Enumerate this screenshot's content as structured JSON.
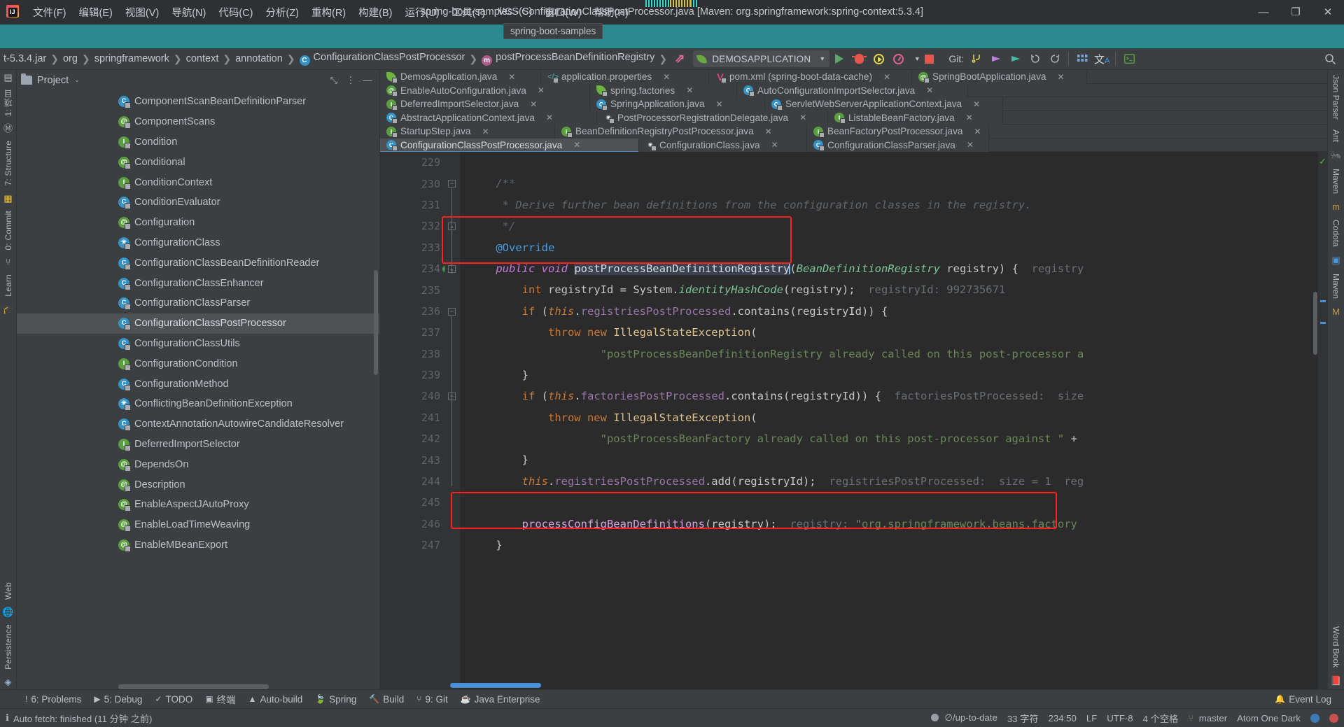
{
  "titlebar": {
    "menus": [
      "文件(F)",
      "编辑(E)",
      "视图(V)",
      "导航(N)",
      "代码(C)",
      "分析(Z)",
      "重构(R)",
      "构建(B)",
      "运行(U)",
      "工具(T)",
      "VCS(S)",
      "窗口(W)",
      "帮助(H)"
    ],
    "window_title": "spring-boot-samples - ConfigurationClassPostProcessor.java [Maven: org.springframework:spring-context:5.3.4]",
    "minimize": "—",
    "restore": "❐",
    "close": "✕"
  },
  "project_tooltip": "spring-boot-samples",
  "breadcrumb": {
    "items": [
      "t-5.3.4.jar",
      "org",
      "springframework",
      "context",
      "annotation",
      "ConfigurationClassPostProcessor",
      "postProcessBeanDefinitionRegistry"
    ],
    "separator": "❯"
  },
  "toolbar": {
    "run_config": "DEMOSAPPLICATION",
    "run_config_caret": "▼",
    "run": "run-button",
    "debug": "debug-button",
    "run_coverage": "run-with-coverage-button",
    "profile": "profiler-button",
    "stop": "stop-button",
    "git_label": "Git:",
    "update": "update-project",
    "commit": "commit",
    "push": "push",
    "history": "history",
    "rollback": "rollback",
    "search": "search-everywhere"
  },
  "left_rail": {
    "project": "1: 项目",
    "structure": "7: Structure",
    "commit": "0: Commit",
    "learn": "Learn",
    "web": "Web",
    "persistence": "Persistence"
  },
  "right_rail": {
    "json_parser": "Json Parser",
    "ant": "Ant",
    "maven": "Maven",
    "codota": "Codota",
    "word_book": "Word Book"
  },
  "project_panel": {
    "title": "Project",
    "caret": "⌄",
    "collapse_icon": "collapse-all-icon",
    "options_icon": "options-icon",
    "hide_icon": "hide-icon",
    "tree": [
      {
        "label": "ComponentScanBeanDefinitionParser",
        "type": "c",
        "selected": false
      },
      {
        "label": "ComponentScans",
        "type": "a",
        "selected": false
      },
      {
        "label": "Condition",
        "type": "i",
        "selected": false
      },
      {
        "label": "Conditional",
        "type": "a",
        "selected": false
      },
      {
        "label": "ConditionContext",
        "type": "i",
        "selected": false
      },
      {
        "label": "ConditionEvaluator",
        "type": "c",
        "selected": false
      },
      {
        "label": "Configuration",
        "type": "a",
        "selected": false
      },
      {
        "label": "ConfigurationClass",
        "type": "ex",
        "selected": false
      },
      {
        "label": "ConfigurationClassBeanDefinitionReader",
        "type": "c",
        "selected": false
      },
      {
        "label": "ConfigurationClassEnhancer",
        "type": "c",
        "selected": false
      },
      {
        "label": "ConfigurationClassParser",
        "type": "c",
        "selected": false
      },
      {
        "label": "ConfigurationClassPostProcessor",
        "type": "c",
        "selected": true
      },
      {
        "label": "ConfigurationClassUtils",
        "type": "c",
        "selected": false
      },
      {
        "label": "ConfigurationCondition",
        "type": "i",
        "selected": false
      },
      {
        "label": "ConfigurationMethod",
        "type": "c",
        "selected": false
      },
      {
        "label": "ConflictingBeanDefinitionException",
        "type": "ex",
        "selected": false
      },
      {
        "label": "ContextAnnotationAutowireCandidateResolver",
        "type": "c",
        "selected": false
      },
      {
        "label": "DeferredImportSelector",
        "type": "i",
        "selected": false
      },
      {
        "label": "DependsOn",
        "type": "a",
        "selected": false
      },
      {
        "label": "Description",
        "type": "a",
        "selected": false
      },
      {
        "label": "EnableAspectJAutoProxy",
        "type": "a",
        "selected": false
      },
      {
        "label": "EnableLoadTimeWeaving",
        "type": "a",
        "selected": false
      },
      {
        "label": "EnableMBeanExport",
        "type": "a",
        "selected": false
      }
    ]
  },
  "editor_tabs": {
    "close_label": "✕",
    "rows": [
      [
        {
          "label": "DemosApplication.java",
          "icon": "spring",
          "active": false
        },
        {
          "label": "application.properties",
          "icon": "prop",
          "active": false
        },
        {
          "label": "pom.xml (spring-boot-data-cache)",
          "icon": "xml",
          "active": false
        },
        {
          "label": "SpringBootApplication.java",
          "icon": "a",
          "active": false
        }
      ],
      [
        {
          "label": "EnableAutoConfiguration.java",
          "icon": "a",
          "active": false
        },
        {
          "label": "spring.factories",
          "icon": "spring",
          "active": false
        },
        {
          "label": "AutoConfigurationImportSelector.java",
          "icon": "c",
          "active": false
        }
      ],
      [
        {
          "label": "DeferredImportSelector.java",
          "icon": "i",
          "active": false
        },
        {
          "label": "SpringApplication.java",
          "icon": "c",
          "active": false
        },
        {
          "label": "ServletWebServerApplicationContext.java",
          "icon": "c",
          "active": false
        }
      ],
      [
        {
          "label": "AbstractApplicationContext.java",
          "icon": "c",
          "active": false
        },
        {
          "label": "PostProcessorRegistrationDelegate.java",
          "icon": "ex",
          "active": false
        },
        {
          "label": "ListableBeanFactory.java",
          "icon": "i",
          "active": false
        }
      ],
      [
        {
          "label": "StartupStep.java",
          "icon": "i",
          "active": false
        },
        {
          "label": "BeanDefinitionRegistryPostProcessor.java",
          "icon": "i",
          "active": false
        },
        {
          "label": "BeanFactoryPostProcessor.java",
          "icon": "i",
          "active": false
        }
      ],
      [
        {
          "label": "ConfigurationClassPostProcessor.java",
          "icon": "c",
          "active": true
        },
        {
          "label": "ConfigurationClass.java",
          "icon": "ex",
          "active": false
        },
        {
          "label": "ConfigurationClassParser.java",
          "icon": "c",
          "active": false
        }
      ]
    ]
  },
  "code": {
    "line_numbers": [
      "229",
      "230",
      "231",
      "232",
      "233",
      "234",
      "235",
      "236",
      "237",
      "238",
      "239",
      "240",
      "241",
      "242",
      "243",
      "244",
      "245",
      "246",
      "247"
    ],
    "lines": [
      "",
      "/**",
      " * Derive further bean definitions from the configuration classes in the registry.",
      " */",
      "@Override",
      "public void postProcessBeanDefinitionRegistry(BeanDefinitionRegistry registry) {  registry",
      "    int registryId = System.identityHashCode(registry);   registryId: 992735671",
      "    if (this.registriesPostProcessed.contains(registryId)) {",
      "        throw new IllegalStateException(",
      "                \"postProcessBeanDefinitionRegistry already called on this post-processor a",
      "    }",
      "    if (this.factoriesPostProcessed.contains(registryId)) {  factoriesPostProcessed:  size",
      "        throw new IllegalStateException(",
      "                \"postProcessBeanFactory already called on this post-processor against \" +",
      "    }",
      "    this.registriesPostProcessed.add(registryId);   registriesPostProcessed:  size = 1  reg",
      "",
      "    processConfigBeanDefinitions(registry);  registry: \"org.springframework.beans.factory",
      "}"
    ],
    "overridden_marker": "O",
    "fold_collapse": "−"
  },
  "tool_window_bar": {
    "items": [
      {
        "icon": "!",
        "label": "6: Problems"
      },
      {
        "icon": "▶",
        "label": "5: Debug"
      },
      {
        "icon": "✓",
        "label": "TODO"
      },
      {
        "icon": "▣",
        "label": "终端"
      },
      {
        "icon": "▲",
        "label": "Auto-build"
      },
      {
        "icon": "🍃",
        "label": "Spring"
      },
      {
        "icon": "🔨",
        "label": "Build"
      },
      {
        "icon": "⑂",
        "label": "9: Git"
      },
      {
        "icon": "☕",
        "label": "Java Enterprise"
      }
    ],
    "event_log": "Event Log",
    "event_log_icon": "bell-icon"
  },
  "status_bar": {
    "message": "Auto fetch: finished (11 分钟 之前)",
    "vcs_status": "∅/up-to-date",
    "chars": "33 字符",
    "caret_position": "234:50",
    "line_separator": "LF",
    "encoding": "UTF-8",
    "indent": "4 个空格",
    "branch": "master",
    "theme": "Atom One Dark"
  },
  "colors": {
    "teal": "#2a8a8f",
    "panel": "#3c3f41",
    "editor_bg": "#2b2b2b",
    "gutter": "#313335",
    "selection": "#4e5254",
    "accent_red": "#ff2020",
    "tab_underline": "#4a88c7"
  }
}
